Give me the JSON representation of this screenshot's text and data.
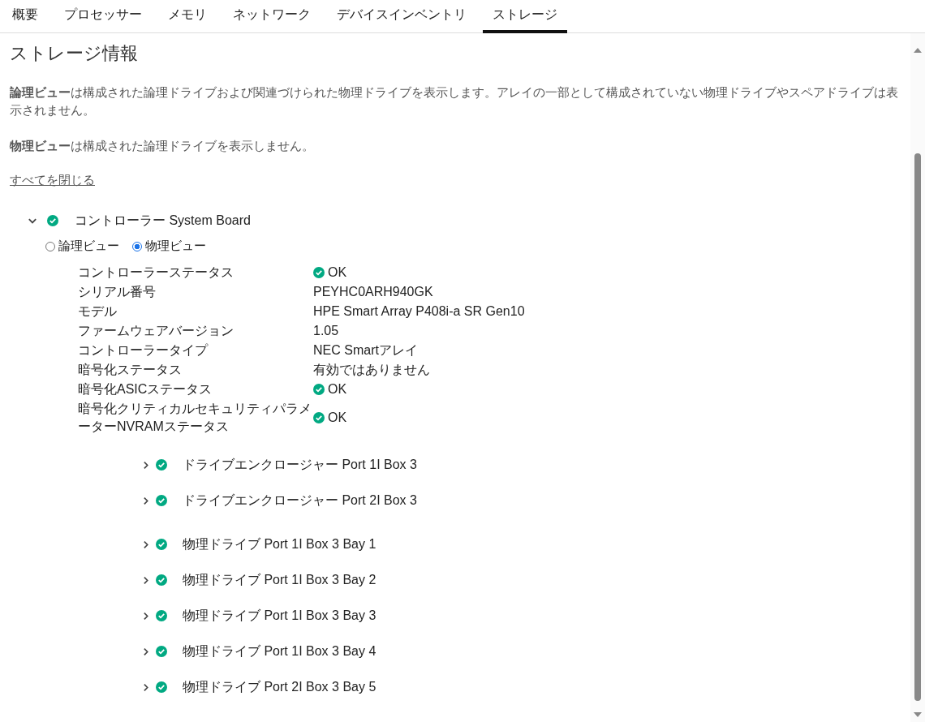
{
  "tabs": [
    {
      "label": "概要",
      "selected": false
    },
    {
      "label": "プロセッサー",
      "selected": false
    },
    {
      "label": "メモリ",
      "selected": false
    },
    {
      "label": "ネットワーク",
      "selected": false
    },
    {
      "label": "デバイスインベントリ",
      "selected": false
    },
    {
      "label": "ストレージ",
      "selected": true
    }
  ],
  "heading": "ストレージ情報",
  "notes": [
    "**論理ビュー**は構成された論理ドライブおよび関連づけられた物理ドライブを表示します。アレイの一部として構成されていない物理ドライブやスペアドライブは表示されません。",
    "**物理ビュー**は構成された論理ドライブを表示しません。"
  ],
  "collapse_link": "すべてを閉じる",
  "controller": {
    "title": "コントローラー System Board",
    "expanded": true,
    "color": "#01a982",
    "views": [
      {
        "label": "論理ビュー",
        "selected": false
      },
      {
        "label": "物理ビュー",
        "selected": true
      }
    ],
    "properties": [
      {
        "label": "コントローラーステータス",
        "value": "OK",
        "kind": "status"
      },
      {
        "label": "シリアル番号",
        "value": "PEYHC0ARH940GK",
        "kind": "text"
      },
      {
        "label": "モデル",
        "value": "HPE Smart Array P408i-a SR Gen10",
        "kind": "text"
      },
      {
        "label": "ファームウェアバージョン",
        "value": "1.05",
        "kind": "text"
      },
      {
        "label": "コントローラータイプ",
        "value": "NEC Smartアレイ",
        "kind": "text"
      },
      {
        "label": "暗号化ステータス",
        "value": "有効ではありません",
        "kind": "text"
      },
      {
        "label": "暗号化ASICステータス",
        "value": "OK",
        "kind": "status"
      },
      {
        "label": "暗号化クリティカルセキュリティパラメーターNVRAMステータス",
        "value": "OK",
        "kind": "status"
      }
    ],
    "enclosures": [
      {
        "title": "ドライブエンクロージャー Port 1I Box 3",
        "expanded": false,
        "color": "#01a982"
      },
      {
        "title": "ドライブエンクロージャー Port 2I Box 3",
        "expanded": false,
        "color": "#01a982"
      }
    ],
    "drives": [
      {
        "title": "物理ドライブ Port 1I Box 3 Bay 1",
        "expanded": false,
        "color": "#01a982"
      },
      {
        "title": "物理ドライブ Port 1I Box 3 Bay 2",
        "expanded": false,
        "color": "#01a982"
      },
      {
        "title": "物理ドライブ Port 1I Box 3 Bay 3",
        "expanded": false,
        "color": "#01a982"
      },
      {
        "title": "物理ドライブ Port 1I Box 3 Bay 4",
        "expanded": false,
        "color": "#01a982"
      },
      {
        "title": "物理ドライブ Port 2I Box 3 Bay 5",
        "expanded": false,
        "color": "#01a982"
      }
    ]
  }
}
